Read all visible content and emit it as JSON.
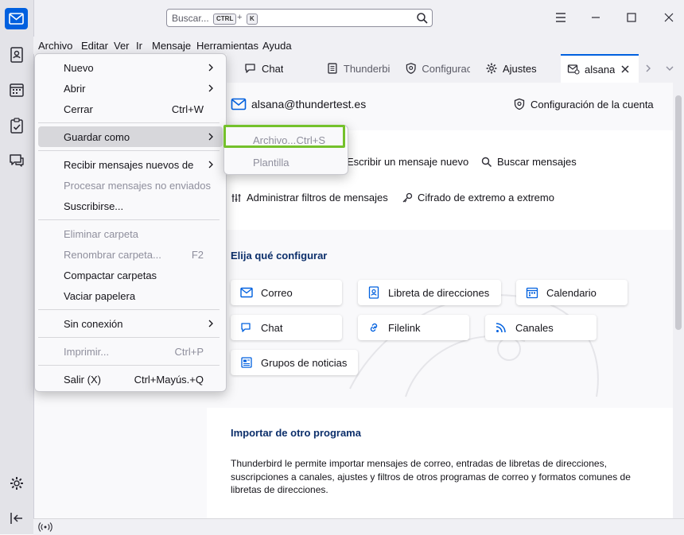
{
  "search": {
    "placeholder": "Buscar...",
    "key1": "CTRL",
    "plus": "+",
    "key2": "K"
  },
  "menubar": [
    "Archivo",
    "Editar",
    "Ver",
    "Ir",
    "Mensaje",
    "Herramientas",
    "Ayuda"
  ],
  "tabs": [
    {
      "label": "Chat",
      "icon": "chat-icon"
    },
    {
      "label": "Thunderbi",
      "icon": "document-icon"
    },
    {
      "label": "Configurac",
      "icon": "shield-gear-icon"
    },
    {
      "label": "Ajustes",
      "icon": "gear-icon"
    },
    {
      "label": "alsana@",
      "icon": "account-mail-icon",
      "active": true
    }
  ],
  "account": {
    "email": "alsana@thundertest.es",
    "settings_label": "Configuración de la cuenta"
  },
  "actions": {
    "write": "Escribir un mensaje nuevo",
    "search": "Buscar mensajes",
    "filters": "Administrar filtros de mensajes",
    "e2e": "Cifrado de extremo a extremo"
  },
  "configure": {
    "heading": "Elija qué configurar",
    "items": [
      "Correo",
      "Libreta de direcciones",
      "Calendario",
      "Chat",
      "Filelink",
      "Canales",
      "Grupos de noticias"
    ]
  },
  "import": {
    "heading": "Importar de otro programa",
    "text": "Thunderbird le permite importar mensajes de correo, entradas de libretas de direcciones, suscripciones a canales, ajustes y filtros de otros programas de correo y formatos comunes de libretas de direcciones."
  },
  "file_menu": [
    {
      "label": "Nuevo",
      "submenu": true
    },
    {
      "label": "Abrir",
      "submenu": true
    },
    {
      "label": "Cerrar",
      "shortcut": "Ctrl+W"
    },
    {
      "label": "Guardar como",
      "submenu": true,
      "highlighted": true
    },
    {
      "label": "Recibir mensajes nuevos de",
      "submenu": true
    },
    {
      "label": "Procesar mensajes no enviados",
      "disabled": true
    },
    {
      "label": "Suscribirse..."
    },
    {
      "label": "Eliminar carpeta",
      "disabled": true
    },
    {
      "label": "Renombrar carpeta...",
      "shortcut": "F2",
      "disabled": true
    },
    {
      "label": "Compactar carpetas"
    },
    {
      "label": "Vaciar papelera"
    },
    {
      "label": "Sin conexión",
      "submenu": true
    },
    {
      "label": "Imprimir...",
      "shortcut": "Ctrl+P",
      "disabled": true
    },
    {
      "label": "Salir (X)",
      "shortcut": "Ctrl+Mayús.+Q"
    }
  ],
  "save_as_menu": [
    {
      "label": "Archivo...",
      "shortcut": "Ctrl+S",
      "disabled": true,
      "highlighted": true
    },
    {
      "label": "Plantilla",
      "disabled": true
    }
  ],
  "colors": {
    "accent": "#0060df",
    "heading": "#0c2f6b",
    "highlight_box": "#74c12b"
  }
}
